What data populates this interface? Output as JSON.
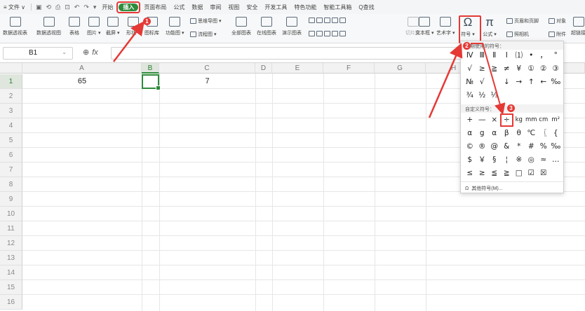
{
  "menubar": {
    "file_label": "≡ 文件 ∨",
    "quick_icons": [
      "▣",
      "⟲",
      "⎙",
      "⊡",
      "↶",
      "↷",
      "▾"
    ],
    "tabs": [
      "开始",
      "插入",
      "页面布局",
      "公式",
      "数据",
      "审阅",
      "视图",
      "安全",
      "开发工具",
      "特色功能",
      "智能工具箱"
    ],
    "active_tab_index": 1,
    "search_label": "Q查找"
  },
  "ribbon": {
    "big_buttons": [
      {
        "label": "数据透视表",
        "icon": "pivot-table-icon"
      },
      {
        "label": "数据透视图",
        "icon": "pivot-chart-icon"
      },
      {
        "label": "表格",
        "icon": "table-icon"
      },
      {
        "label": "图片 ▾",
        "icon": "picture-icon"
      },
      {
        "label": "截屏 ▾",
        "icon": "screenshot-icon"
      },
      {
        "label": "形状 ▾",
        "icon": "shape-icon"
      },
      {
        "label": "图标库",
        "icon": "icon-library-icon"
      },
      {
        "label": "功能图 ▾",
        "icon": "function-chart-icon"
      },
      {
        "label": "全部图表",
        "icon": "all-charts-icon"
      },
      {
        "label": "在线图表",
        "icon": "online-chart-icon"
      },
      {
        "label": "演示图表",
        "icon": "demo-chart-icon"
      },
      {
        "label": "切片器",
        "icon": "slicer-icon"
      },
      {
        "label": "文本框 ▾",
        "icon": "textbox-icon"
      },
      {
        "label": "艺术字 ▾",
        "icon": "wordart-icon"
      },
      {
        "label": "符号 ▾",
        "icon": "omega-icon"
      },
      {
        "label": "公式 ▾",
        "icon": "pi-icon"
      }
    ],
    "small_buttons": [
      {
        "label": "思维导图 ▾"
      },
      {
        "label": "流程图 ▾"
      },
      {
        "label": "页眉和页脚"
      },
      {
        "label": "对象"
      },
      {
        "label": "照相机"
      },
      {
        "label": "附件"
      },
      {
        "label": "超链接"
      }
    ]
  },
  "formula_bar": {
    "name_box": "B1",
    "fx_label": "fx",
    "zoom_icon": "⊕",
    "formula_value": ""
  },
  "grid": {
    "columns": [
      "A",
      "B",
      "C",
      "D",
      "E",
      "F",
      "G",
      "H"
    ],
    "rows": [
      "1",
      "2",
      "3",
      "4",
      "5",
      "6",
      "7",
      "8",
      "9",
      "10",
      "11",
      "12",
      "13",
      "14",
      "15",
      "16"
    ],
    "selected_column": "B",
    "selected_row": "1",
    "cells": {
      "A1": "65",
      "C1": "7"
    }
  },
  "symbol_panel": {
    "recent_header": "近期使用的符号：",
    "recent_rows": [
      [
        "Ⅳ",
        "Ⅲ",
        "Ⅱ",
        "Ⅰ",
        "⑴",
        "•",
        "，",
        "°"
      ],
      [
        "√",
        "≥",
        "≧",
        "≠",
        "¥",
        "①",
        "②",
        "③"
      ],
      [
        "№",
        "√",
        "",
        "↓",
        "→",
        "↑",
        "←",
        "‰"
      ],
      [
        "¾",
        "½",
        "⅓",
        "",
        "",
        "",
        "",
        ""
      ]
    ],
    "custom_header": "自定义符号：",
    "custom_rows": [
      [
        "+",
        "—",
        "×",
        "÷",
        "kg",
        "mm",
        "cm",
        "m²"
      ],
      [
        "α",
        "g",
        "α",
        "β",
        "θ",
        "℃",
        "〖",
        "{"
      ],
      [
        "©",
        "®",
        "@",
        "&",
        "*",
        "#",
        "%",
        "‰"
      ],
      [
        "$",
        "￥",
        "§",
        "¦",
        "※",
        "◎",
        "≈",
        "…"
      ],
      [
        "≤",
        "≥",
        "≦",
        "≧",
        "□",
        "☑",
        "☒",
        ""
      ]
    ],
    "highlighted_symbol": "÷",
    "more_label": "其他符号(M)...",
    "more_icon": "Ω"
  },
  "steps": [
    "1",
    "2",
    "3"
  ],
  "colors": {
    "accent": "#2e8b3a",
    "annotation": "#e53935"
  }
}
